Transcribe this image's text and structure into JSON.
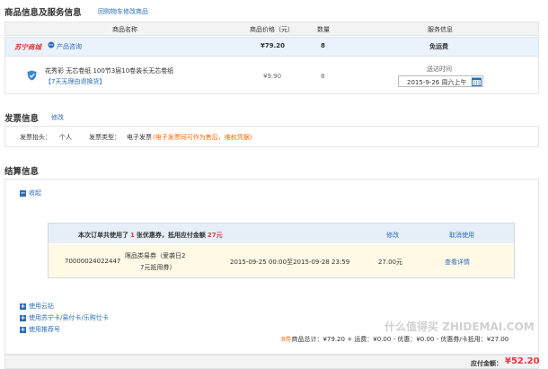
{
  "goods": {
    "title": "商品信息及服务信息",
    "back_link": "回购物车修改商品",
    "columns": [
      "商品名称",
      "商品价格（元）",
      "数量",
      "服务信息"
    ],
    "store": {
      "name": "苏宁商城",
      "consult": "产品咨询",
      "subtotal": "¥79.20",
      "qty": "8",
      "shipping": "免运费"
    },
    "item": {
      "name": "花秀彩 无芯卷纸 100节3层10卷装长无芯卷纸",
      "return_tag": "【7天无理由退换货】",
      "price": "¥9.90",
      "qty": "8",
      "delivery_label": "送达时间",
      "delivery_value": "2015-9-26 周六上午"
    }
  },
  "invoice": {
    "title": "发票信息",
    "edit_link": "修改",
    "head_label": "发票抬头：",
    "head_value": "个人",
    "type_label": "发票类型：",
    "type_value": "电子发票",
    "type_note": "(电子发票同可作为售后，维权凭据)"
  },
  "settle": {
    "title": "结算信息",
    "collapse_label": "收起",
    "coupon_summary_prefix": "本次订单共使用了",
    "coupon_count": "1",
    "coupon_summary_mid": "张优惠券，抵用应付金额",
    "coupon_amount": "27元",
    "coupon_edit": "修改",
    "coupon_cancel": "取消使用",
    "coupon": {
      "code": "70000024022447",
      "name_line1": "限品类易券（爱袭日2",
      "name_line2": "7元抵用券）",
      "validity": "2015-09-25 00:00至2015-09-28 23:59",
      "value": "27.00元",
      "detail": "查看详情"
    },
    "options": [
      "使用云钻",
      "使用苏宁卡/易付卡/乐购仕卡",
      "使用推荐号"
    ],
    "totals": {
      "count": "8件",
      "goods_total_label": "商品总计：",
      "goods_total": "¥79.20",
      "shipping_label": "+ 运费：",
      "shipping": "¥0.00",
      "discount_label": "- 优惠：",
      "discount": "¥0.00",
      "coupon_label": "- 优惠券/卡抵用：",
      "coupon": "¥27.00"
    },
    "payable_label": "应付金额：",
    "payable": "¥52.20"
  },
  "watermark": "什么值得买 ZHIDEMAI.COM"
}
